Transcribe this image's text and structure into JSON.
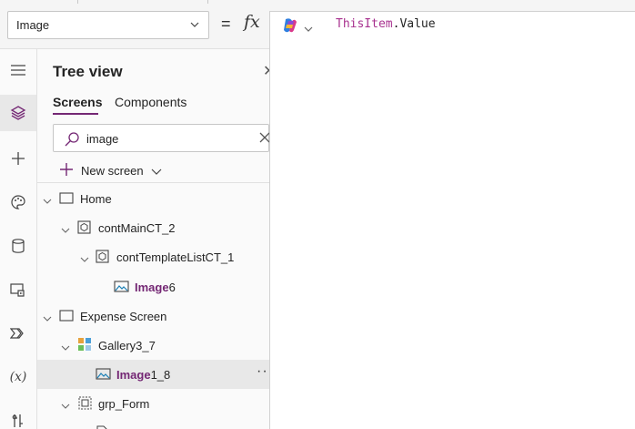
{
  "formula_bar": {
    "property": "Image",
    "equals": "=",
    "fx": "fx",
    "formula_keyword": "ThisItem",
    "formula_dot": ".",
    "formula_member": "Value"
  },
  "tree_view": {
    "title": "Tree view",
    "tabs": [
      {
        "label": "Screens",
        "active": true
      },
      {
        "label": "Components",
        "active": false
      }
    ],
    "search_value": "image",
    "new_screen_label": "New screen",
    "nodes": [
      {
        "label": "Home",
        "highlight": "",
        "suffix": "",
        "icon": "screen-icon"
      },
      {
        "label": "contMainCT_2",
        "highlight": "",
        "suffix": "",
        "icon": "container-icon"
      },
      {
        "label": "contTemplateListCT_1",
        "highlight": "",
        "suffix": "",
        "icon": "container-icon"
      },
      {
        "label": "",
        "highlight": "Image",
        "suffix": "6",
        "icon": "image-icon"
      },
      {
        "label": "Expense Screen",
        "highlight": "",
        "suffix": "",
        "icon": "screen-icon"
      },
      {
        "label": "Gallery3_7",
        "highlight": "",
        "suffix": "",
        "icon": "gallery-icon"
      },
      {
        "label": "",
        "highlight": "Image",
        "suffix": "1_8",
        "icon": "image-icon",
        "selected": true
      },
      {
        "label": "grp_Form",
        "highlight": "",
        "suffix": "",
        "icon": "group-icon"
      }
    ],
    "more_label": "···"
  },
  "rail": {
    "items": [
      "hamburger-icon",
      "tree-view-icon",
      "insert-icon",
      "theme-icon",
      "data-icon",
      "media-icon",
      "power-automate-icon",
      "variables-icon",
      "tools-icon"
    ],
    "variables_glyph": "(x)"
  },
  "colors": {
    "accent": "#742774",
    "keyword": "#a8328f",
    "selected_row": "#e8e8e8"
  }
}
